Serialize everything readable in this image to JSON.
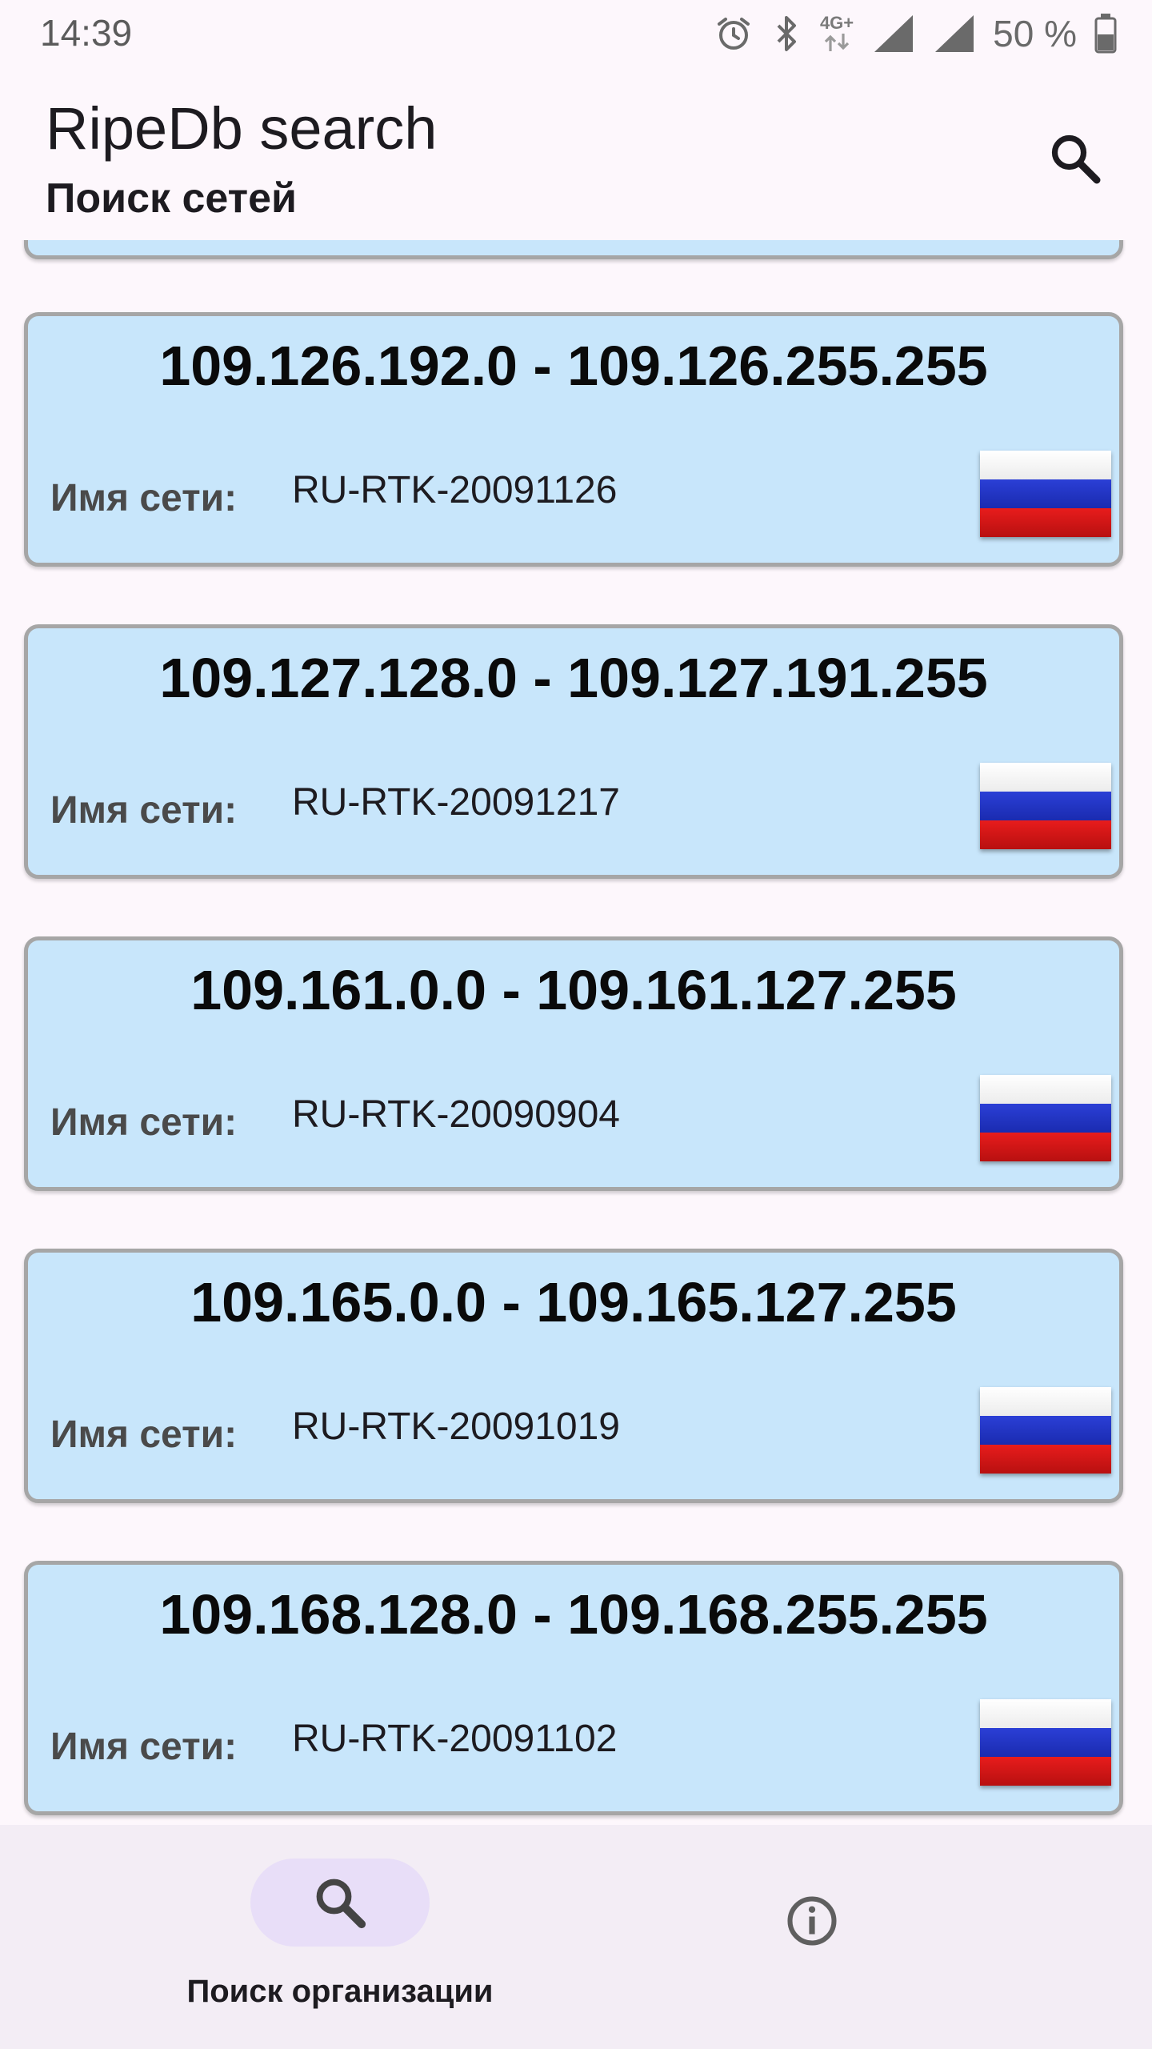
{
  "status_bar": {
    "time": "14:39",
    "network": "4G+",
    "battery": "50 %",
    "icons": [
      "alarm-icon",
      "bluetooth-icon",
      "network-4g-icon",
      "signal-icon",
      "signal-icon",
      "battery-icon"
    ]
  },
  "app_bar": {
    "title": "RipeDb search",
    "subtitle": "Поиск сетей",
    "search_icon": "search-icon"
  },
  "list": {
    "label": "Имя сети:",
    "items": [
      {
        "range": "",
        "name": ""
      },
      {
        "range": "109.126.192.0 - 109.126.255.255",
        "name": "RU-RTK-20091126",
        "flag": "russia-flag-icon"
      },
      {
        "range": "109.127.128.0 - 109.127.191.255",
        "name": "RU-RTK-20091217",
        "flag": "russia-flag-icon"
      },
      {
        "range": "109.161.0.0 - 109.161.127.255",
        "name": "RU-RTK-20090904",
        "flag": "russia-flag-icon"
      },
      {
        "range": "109.165.0.0 - 109.165.127.255",
        "name": "RU-RTK-20091019",
        "flag": "russia-flag-icon"
      },
      {
        "range": "109.168.128.0 - 109.168.255.255",
        "name": "RU-RTK-20091102",
        "flag": "russia-flag-icon"
      }
    ]
  },
  "bottom_nav": {
    "search_label": "Поиск организации",
    "search_icon": "search-icon",
    "info_icon": "info-icon"
  },
  "colors": {
    "card_bg": "#c8e6fb",
    "card_border": "#a6a6a6",
    "page_bg": "#fdf7fc",
    "nav_bg": "#f3edf5",
    "nav_pill": "#e8def8"
  }
}
